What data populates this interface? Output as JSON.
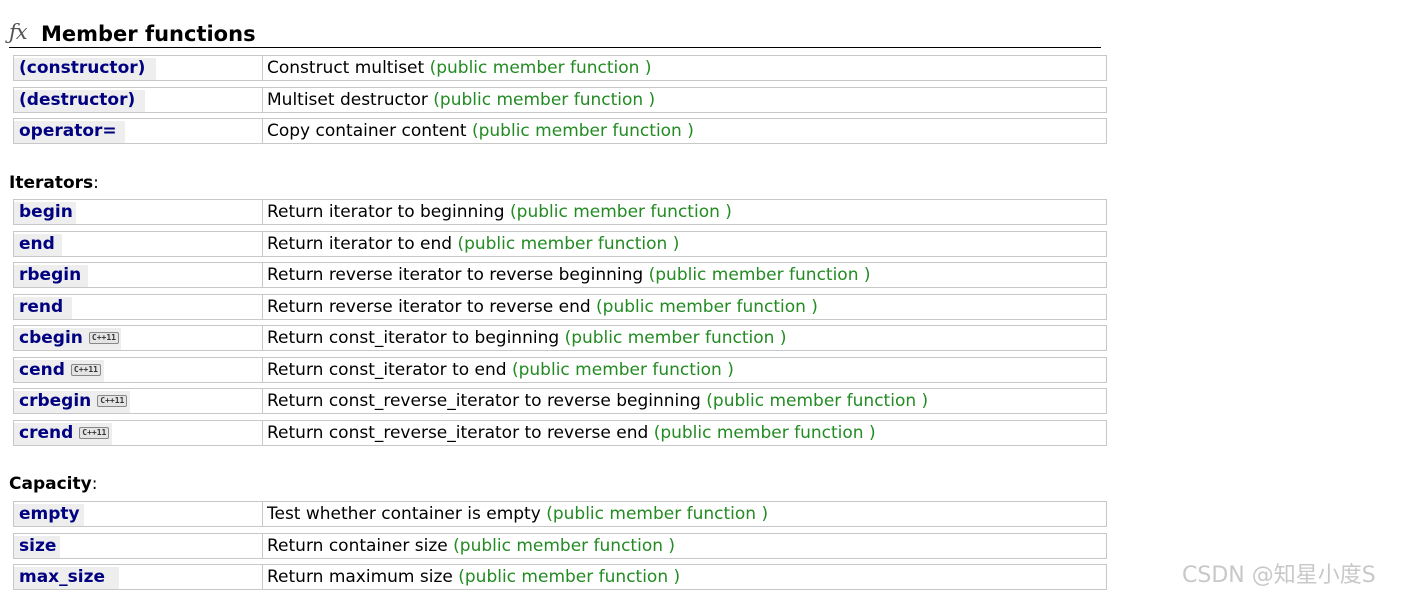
{
  "header": {
    "icon": "fx-icon",
    "title": "Member functions"
  },
  "groups": [
    {
      "title": "",
      "rows": [
        {
          "name": "(constructor)",
          "cpp11": false,
          "desc": "Construct multiset",
          "kind": "(public member function )"
        },
        {
          "name": "(destructor)",
          "cpp11": false,
          "desc": "Multiset destructor",
          "kind": "(public member function )"
        },
        {
          "name": "operator=",
          "cpp11": false,
          "desc": "Copy container content",
          "kind": "(public member function )"
        }
      ]
    },
    {
      "title": "Iterators",
      "rows": [
        {
          "name": "begin",
          "cpp11": false,
          "desc": "Return iterator to beginning",
          "kind": "(public member function )"
        },
        {
          "name": "end",
          "cpp11": false,
          "desc": "Return iterator to end",
          "kind": "(public member function )"
        },
        {
          "name": "rbegin",
          "cpp11": false,
          "desc": "Return reverse iterator to reverse beginning",
          "kind": "(public member function )"
        },
        {
          "name": "rend",
          "cpp11": false,
          "desc": "Return reverse iterator to reverse end",
          "kind": "(public member function )"
        },
        {
          "name": "cbegin",
          "cpp11": true,
          "desc": "Return const_iterator to beginning",
          "kind": "(public member function )"
        },
        {
          "name": "cend",
          "cpp11": true,
          "desc": "Return const_iterator to end",
          "kind": "(public member function )"
        },
        {
          "name": "crbegin",
          "cpp11": true,
          "desc": "Return const_reverse_iterator to reverse beginning",
          "kind": "(public member function )"
        },
        {
          "name": "crend",
          "cpp11": true,
          "desc": "Return const_reverse_iterator to reverse end",
          "kind": "(public member function )"
        }
      ]
    },
    {
      "title": "Capacity",
      "rows": [
        {
          "name": "empty",
          "cpp11": false,
          "desc": "Test whether container is empty",
          "kind": "(public member function )"
        },
        {
          "name": "size",
          "cpp11": false,
          "desc": "Return container size",
          "kind": "(public member function )"
        },
        {
          "name": "max_size",
          "cpp11": false,
          "desc": "Return maximum size",
          "kind": "(public member function )"
        }
      ]
    }
  ],
  "cpp11_badge": "C++11",
  "group_colon": ":",
  "watermark": "CSDN @知星小度S",
  "colors": {
    "name_link": "#000080",
    "kind_tag": "#228b22",
    "row_border": "#c8c8c8",
    "name_bg": "#eeeeee"
  }
}
